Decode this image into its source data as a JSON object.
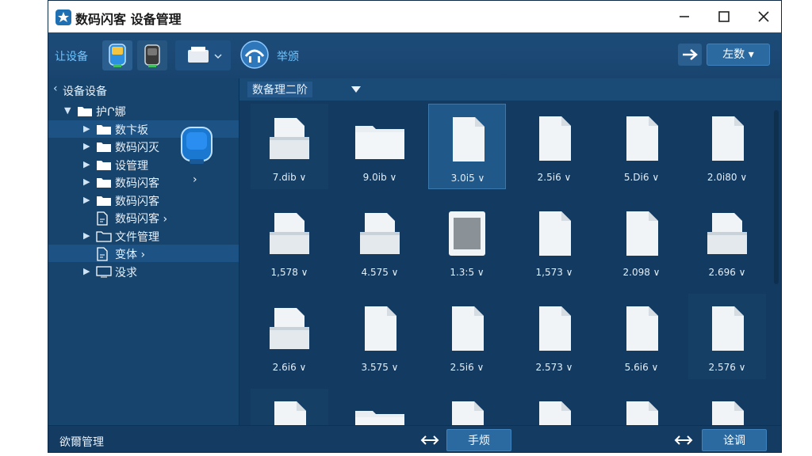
{
  "window": {
    "title": "数码闪客 设备管理"
  },
  "toolbar": {
    "device_label": "让设备",
    "action_label": "举颁",
    "right_button_label": "左数 ▾"
  },
  "sidebar": {
    "header": "设备设备",
    "items": [
      {
        "label": "护Ր娜",
        "level": 0,
        "expanded": true,
        "icon": "folder-icon"
      },
      {
        "label": "数卞坂",
        "level": 1,
        "expanded": false,
        "icon": "folder-icon"
      },
      {
        "label": "数码闪灭",
        "level": 1,
        "expanded": false,
        "icon": "folder-icon"
      },
      {
        "label": "设管理",
        "level": 1,
        "expanded": false,
        "icon": "folder-icon"
      },
      {
        "label": "数码闪客",
        "level": 1,
        "expanded": false,
        "icon": "folder-icon"
      },
      {
        "label": "数码闪客",
        "level": 1,
        "expanded": false,
        "icon": "folder-icon"
      },
      {
        "label": "数码闪客 ›",
        "level": 1,
        "expanded": false,
        "icon": "file-icon"
      },
      {
        "label": "文件管理",
        "level": 1,
        "expanded": false,
        "icon": "folder-outline-icon"
      },
      {
        "label": "变体 ›",
        "level": 1,
        "expanded": false,
        "icon": "file-icon"
      },
      {
        "label": "没求",
        "level": 1,
        "expanded": false,
        "icon": "monitor-icon"
      }
    ]
  },
  "main": {
    "path": "数备理二阶",
    "files": [
      {
        "label": "7.dib ∨"
      },
      {
        "label": "9.0ib ∨"
      },
      {
        "label": "3.0i5 ∨"
      },
      {
        "label": "2.5i6 ∨"
      },
      {
        "label": "5.Di6 ∨"
      },
      {
        "label": "2.0i80 ∨"
      },
      {
        "label": "1,578 ∨"
      },
      {
        "label": "4.575 ∨"
      },
      {
        "label": "1.3:5 ∨"
      },
      {
        "label": "1,573 ∨"
      },
      {
        "label": "2.098 ∨"
      },
      {
        "label": "2.696 ∨"
      },
      {
        "label": "2.6i6 ∨"
      },
      {
        "label": "3.575 ∨"
      },
      {
        "label": "2.5i6 ∨"
      },
      {
        "label": "2.573 ∨"
      },
      {
        "label": "5.6i6 ∨"
      },
      {
        "label": "2.576 ∨"
      },
      {
        "label": ""
      },
      {
        "label": ""
      },
      {
        "label": ""
      },
      {
        "label": ""
      },
      {
        "label": ""
      },
      {
        "label": ""
      }
    ]
  },
  "statusbar": {
    "text": "欲爾管理",
    "left_button": "手烦",
    "right_button": "诠调"
  }
}
